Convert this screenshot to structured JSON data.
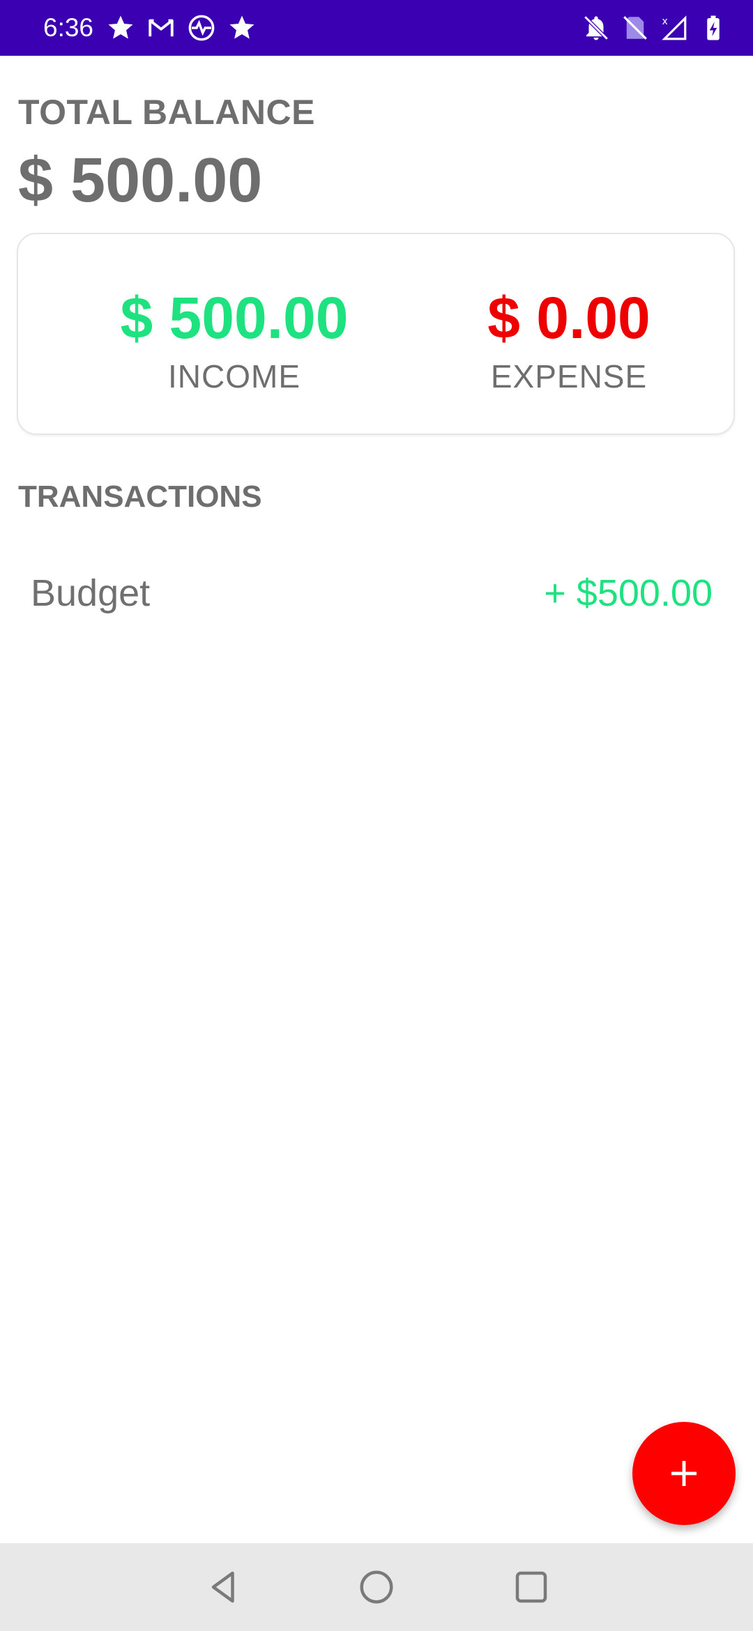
{
  "status_bar": {
    "time": "6:36",
    "left_icons": [
      "star-icon",
      "gmail-icon",
      "activity-icon",
      "star-icon"
    ],
    "right_icons": [
      "bell-off-icon",
      "no-sim-icon",
      "signal-icon",
      "battery-charging-icon"
    ],
    "background": "#3a00b2"
  },
  "balance": {
    "label": "TOTAL BALANCE",
    "value": "$ 500.00"
  },
  "summary": {
    "income": {
      "amount": "$ 500.00",
      "label": "INCOME",
      "color": "#1de27f"
    },
    "expense": {
      "amount": "$ 0.00",
      "label": "EXPENSE",
      "color": "#ee0000"
    }
  },
  "transactions": {
    "label": "TRANSACTIONS",
    "items": [
      {
        "name": "Budget",
        "amount": "+ $500.00",
        "color": "#1de27f"
      }
    ]
  },
  "fab": {
    "icon": "plus-icon",
    "label": "+",
    "color": "#ff0000"
  },
  "nav_bar": {
    "buttons": [
      "back-icon",
      "home-icon",
      "recents-icon"
    ]
  }
}
